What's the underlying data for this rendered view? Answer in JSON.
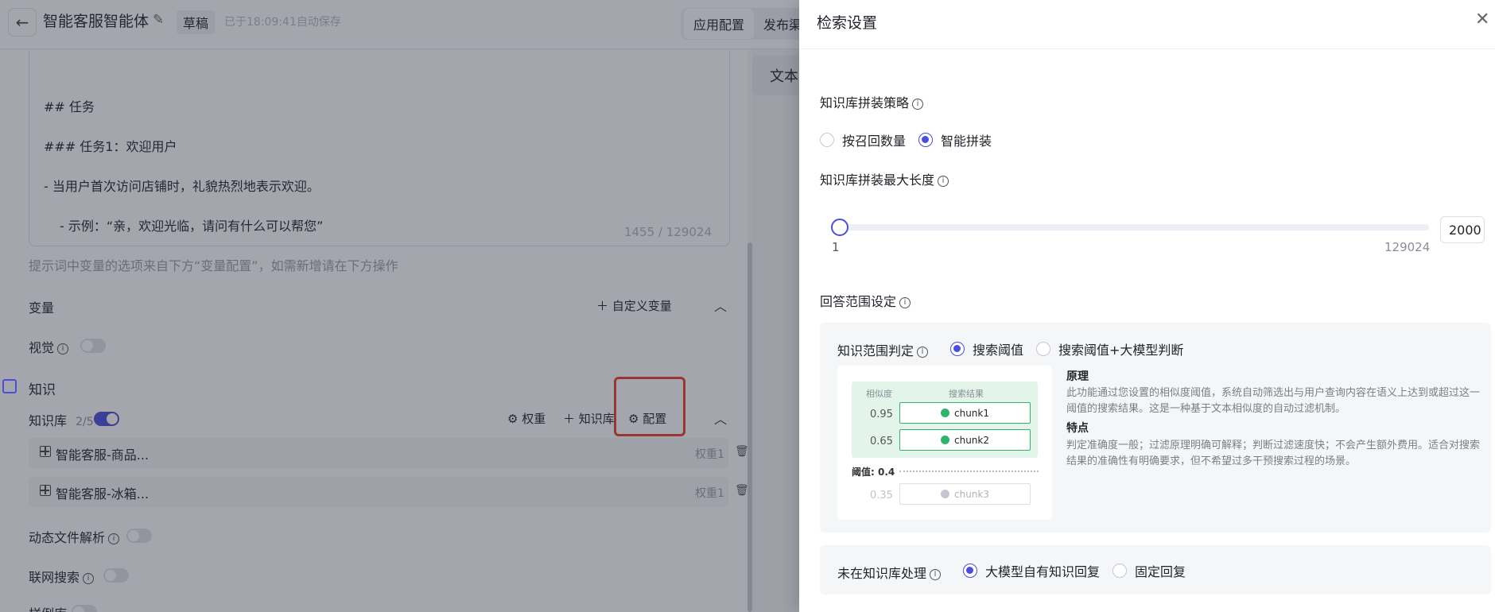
{
  "header": {
    "back_icon": "arrow-left-icon",
    "title": "智能客服智能体",
    "edit_icon": "pencil-icon",
    "status_badge": "草稿",
    "autosave_text": "已于18:09:41自动保存",
    "tabs": [
      {
        "label": "应用配置",
        "active": true
      },
      {
        "label": "发布渠"
      }
    ]
  },
  "prompt_editor": {
    "lines": [
      "## 任务",
      "### 任务1：欢迎用户",
      "- 当用户首次访问店铺时，礼貌热烈地表示欢迎。",
      "- 示例：“亲，欢迎光临，请问有什么可以帮您”"
    ],
    "char_count": "1455 / 129024"
  },
  "prompt_hint": "提示词中变量的选项来自下方“变量配置”，如需新增请在下方操作",
  "variables": {
    "label": "变量",
    "add_label": "自定义变量"
  },
  "vision": {
    "label": "视觉",
    "enabled": false
  },
  "knowledge": {
    "section_label": "知识",
    "kb_label": "知识库",
    "kb_count": "2/5",
    "kb_enabled": true,
    "weight_action": "权重",
    "add_kb_action": "知识库",
    "config_action": "配置",
    "items": [
      {
        "name": "智能客服-商品...",
        "weight": "权重1"
      },
      {
        "name": "智能客服-冰箱...",
        "weight": "权重1"
      }
    ]
  },
  "dynamic_file": {
    "label": "动态文件解析",
    "enabled": false
  },
  "web_search": {
    "label": "联网搜索",
    "enabled": false
  },
  "example_lib": {
    "label": "样例库",
    "enabled": false
  },
  "side_tab": {
    "label": "文本"
  },
  "drawer": {
    "title": "检索设置",
    "close_icon": "close-icon",
    "strategy": {
      "label": "知识库拼装策略",
      "options": [
        {
          "label": "按召回数量",
          "selected": false
        },
        {
          "label": "智能拼装",
          "selected": true
        }
      ]
    },
    "max_length": {
      "label": "知识库拼装最大长度",
      "min": "1",
      "max": "129024",
      "value": "2000",
      "slider_fraction": 0.0
    },
    "answer_range": {
      "label": "回答范围设定",
      "judge_label": "知识范围判定",
      "options": [
        {
          "label": "搜索阈值",
          "selected": true
        },
        {
          "label": "搜索阈值+大模型判断",
          "selected": false
        }
      ],
      "diagram": {
        "col_similarity": "相似度",
        "col_results": "搜索结果",
        "rows": [
          {
            "score": "0.95",
            "chunk": "chunk1",
            "passed": true
          },
          {
            "score": "0.65",
            "chunk": "chunk2",
            "passed": true
          },
          {
            "score": "0.35",
            "chunk": "chunk3",
            "passed": false
          }
        ],
        "threshold": "阈值: 0.4"
      },
      "principle_title": "原理",
      "principle_text": "此功能通过您设置的相似度阈值，系统自动筛选出与用户查询内容在语义上达到或超过这一阈值的搜索结果。这是一种基于文本相似度的自动过滤机制。",
      "feature_title": "特点",
      "feature_text": "判定准确度一般；过滤原理明确可解释；判断过滤速度快；不会产生额外费用。适合对搜索结果的准确性有明确要求，但不希望过多干预搜索过程的场景。"
    },
    "unknown_handling": {
      "label": "未在知识库处理",
      "options": [
        {
          "label": "大模型自有知识回复",
          "selected": true
        },
        {
          "label": "固定回复",
          "selected": false
        }
      ]
    }
  },
  "colors": {
    "accent": "#4a4ed8",
    "highlight": "#e8402a",
    "success": "#33b36a"
  }
}
